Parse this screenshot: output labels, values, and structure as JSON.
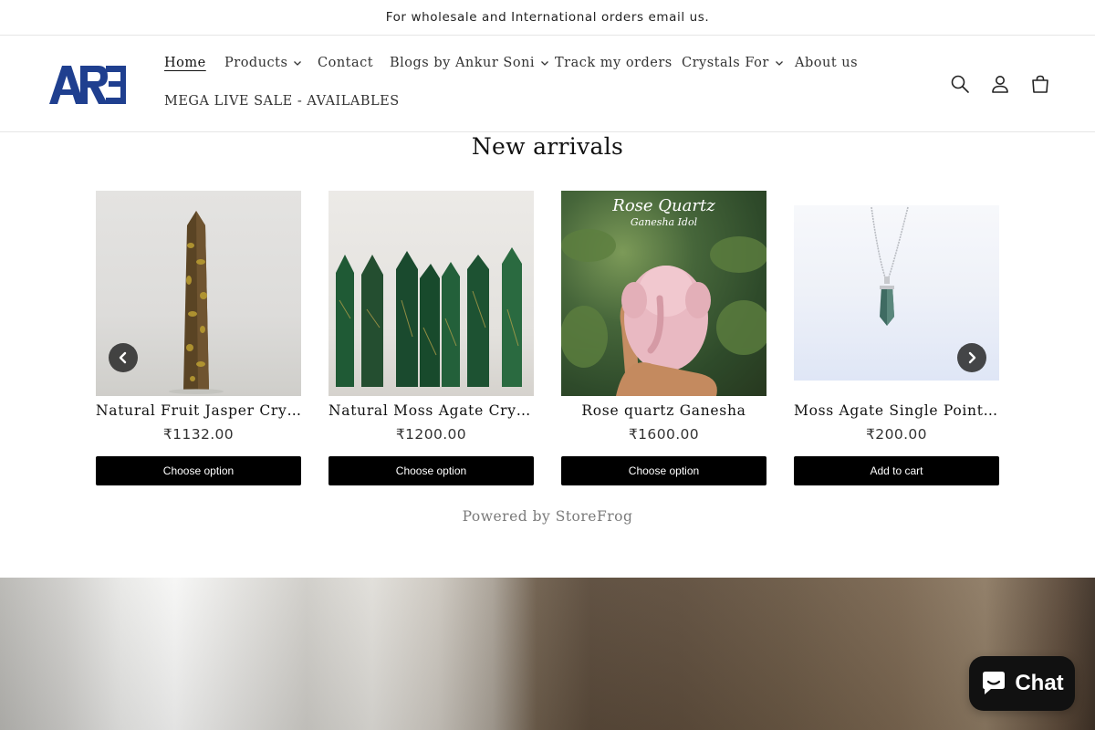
{
  "announcement": "For wholesale and International orders email us.",
  "logo_text": "ARE",
  "nav": {
    "home": "Home",
    "products": "Products",
    "contact": "Contact",
    "blogs": "Blogs by Ankur Soni",
    "track": "Track my orders",
    "crystals_for": "Crystals For",
    "about": "About us",
    "mega_sale": "MEGA LIVE SALE - AVAILABLES"
  },
  "icons": {
    "search": "search-icon",
    "account": "account-icon",
    "cart": "cart-icon",
    "prev": "chevron-left-icon",
    "next": "chevron-right-icon",
    "chat": "chat-bubble-icon"
  },
  "section_title": "New arrivals",
  "products": [
    {
      "title": "Natural Fruit Jasper Crystal Tower",
      "price": "₹1132.00",
      "button": "Choose option"
    },
    {
      "title": "Natural Moss Agate Crystal Towers",
      "price": "₹1200.00",
      "button": "Choose option"
    },
    {
      "title": "Rose quartz Ganesha",
      "price": "₹1600.00",
      "button": "Choose option",
      "image_text": {
        "line1": "Rose Quartz",
        "line2": "Ganesha Idol"
      }
    },
    {
      "title": "Moss Agate Single Point Pendant",
      "price": "₹200.00",
      "button": "Add to cart"
    }
  ],
  "powered_by": "Powered by StoreFrog",
  "chat_label": "Chat",
  "colors": {
    "button_bg": "#000000",
    "text": "#121212",
    "muted": "#7a7a7a",
    "logo_blue": "#1f3f8f"
  }
}
